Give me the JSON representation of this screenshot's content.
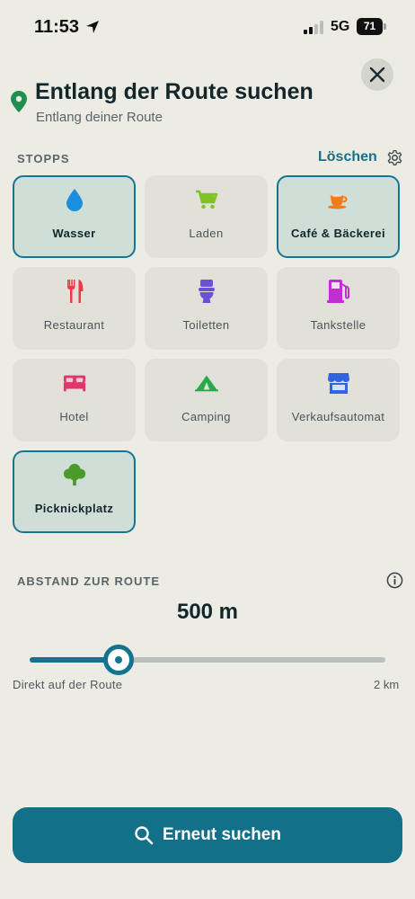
{
  "status_bar": {
    "time": "11:53",
    "network": "5G",
    "battery": "71"
  },
  "header": {
    "title": "Entlang der Route suchen",
    "subtitle": "Entlang deiner Route",
    "close_icon": "close-icon"
  },
  "stops": {
    "section_label": "STOPPS",
    "clear_label": "Löschen",
    "items": [
      {
        "label": "Wasser",
        "icon": "water-drop-icon",
        "color": "#1a8fe0",
        "selected": true
      },
      {
        "label": "Laden",
        "icon": "shopping-cart-icon",
        "color": "#7fc222",
        "selected": false
      },
      {
        "label": "Café & Bäckerei",
        "icon": "coffee-cup-icon",
        "color": "#f27c1c",
        "selected": true
      },
      {
        "label": "Restaurant",
        "icon": "fork-knife-icon",
        "color": "#f0384a",
        "selected": false
      },
      {
        "label": "Toiletten",
        "icon": "toilet-icon",
        "color": "#6a52d8",
        "selected": false
      },
      {
        "label": "Tankstelle",
        "icon": "fuel-pump-icon",
        "color": "#c030d0",
        "selected": false
      },
      {
        "label": "Hotel",
        "icon": "bed-icon",
        "color": "#e0356d",
        "selected": false
      },
      {
        "label": "Camping",
        "icon": "tent-icon",
        "color": "#2aa84c",
        "selected": false
      },
      {
        "label": "Verkaufsautomat",
        "icon": "storefront-icon",
        "color": "#2f66e0",
        "selected": false
      },
      {
        "label": "Picknickplatz",
        "icon": "tree-icon",
        "color": "#4c9a2a",
        "selected": true
      }
    ]
  },
  "distance": {
    "section_label": "ABSTAND ZUR ROUTE",
    "value": "500 m",
    "slider_fraction": 0.25,
    "min_label": "Direkt auf der Route",
    "max_label": "2 km"
  },
  "action": {
    "search_label": "Erneut suchen"
  },
  "colors": {
    "accent": "#137089",
    "pin": "#1e8f4e",
    "background": "#ecece4"
  }
}
